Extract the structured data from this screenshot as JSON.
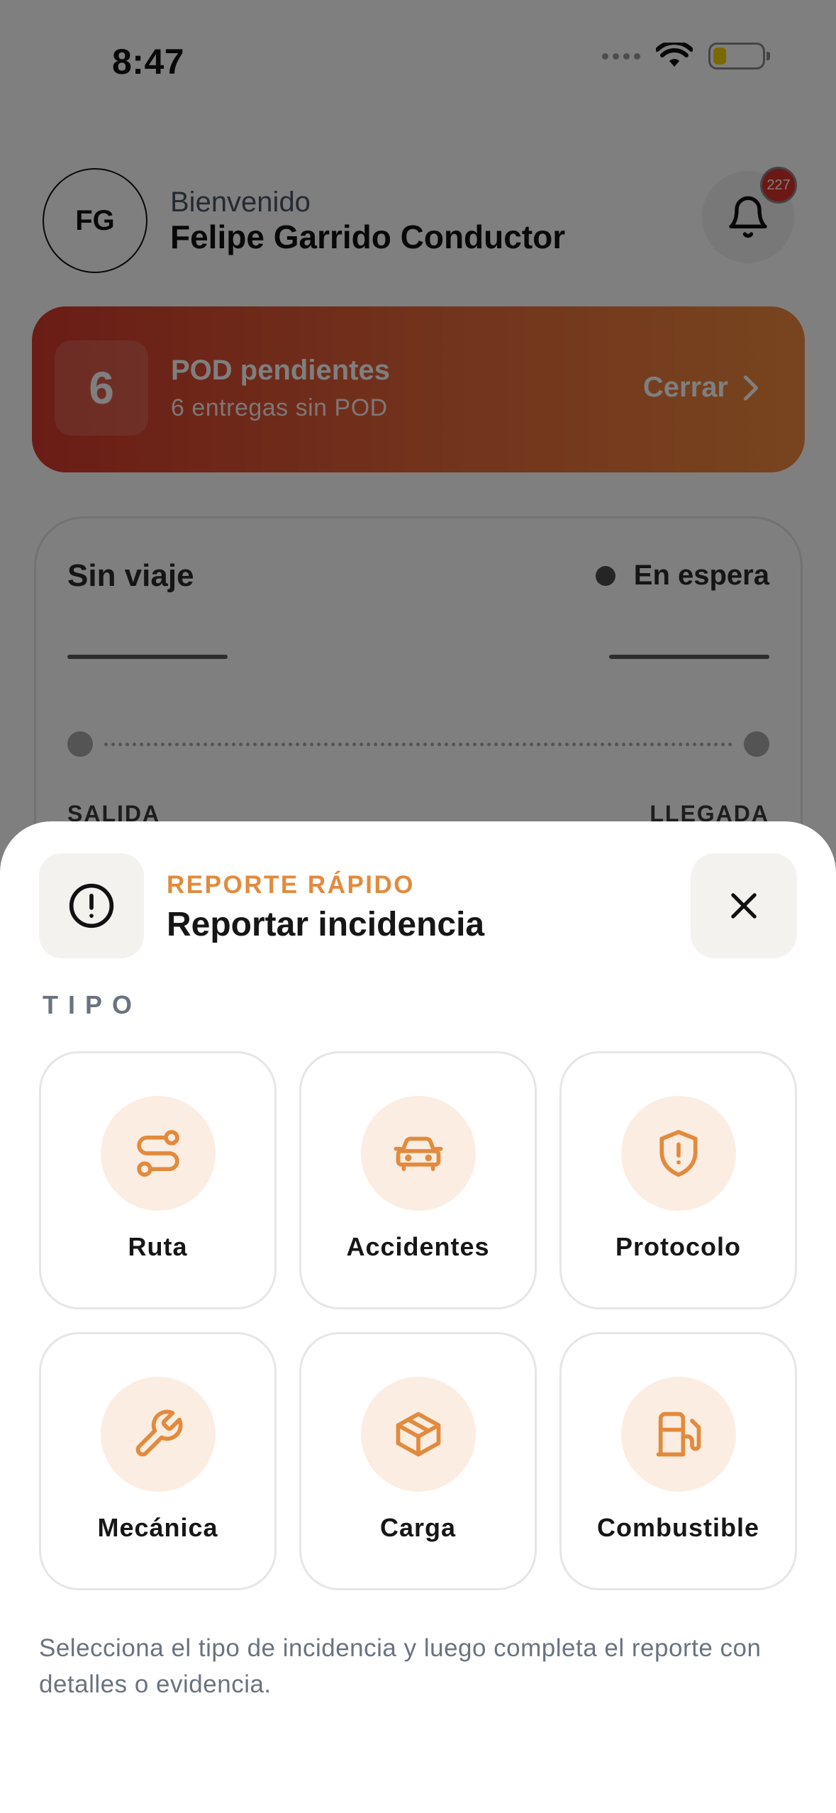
{
  "status_bar": {
    "time": "8:47"
  },
  "header": {
    "avatar_initials": "FG",
    "welcome": "Bienvenido",
    "name": "Felipe Garrido Conductor",
    "notification_count": "227"
  },
  "pod_banner": {
    "count": "6",
    "title": "POD pendientes",
    "subtitle": "6 entregas sin POD",
    "close_label": "Cerrar"
  },
  "trip_card": {
    "title": "Sin viaje",
    "status": "En espera",
    "origin_label": "SALIDA",
    "destination_label": "LLEGADA"
  },
  "sheet": {
    "eyebrow": "REPORTE RÁPIDO",
    "title": "Reportar incidencia",
    "section_label": "TIPO",
    "types": [
      {
        "label": "Ruta",
        "icon": "route-icon"
      },
      {
        "label": "Accidentes",
        "icon": "car-icon"
      },
      {
        "label": "Protocolo",
        "icon": "shield-alert-icon"
      },
      {
        "label": "Mecánica",
        "icon": "wrench-icon"
      },
      {
        "label": "Carga",
        "icon": "package-icon"
      },
      {
        "label": "Combustible",
        "icon": "fuel-icon"
      }
    ],
    "helper_text": "Selecciona el tipo de incidencia y luego completa el reporte con detalles o evidencia."
  },
  "colors": {
    "accent": "#e28a3d",
    "accent_soft": "#fbede1",
    "banner_start": "#d43a2c",
    "banner_end": "#ef8a3e",
    "badge": "#d9302b"
  }
}
